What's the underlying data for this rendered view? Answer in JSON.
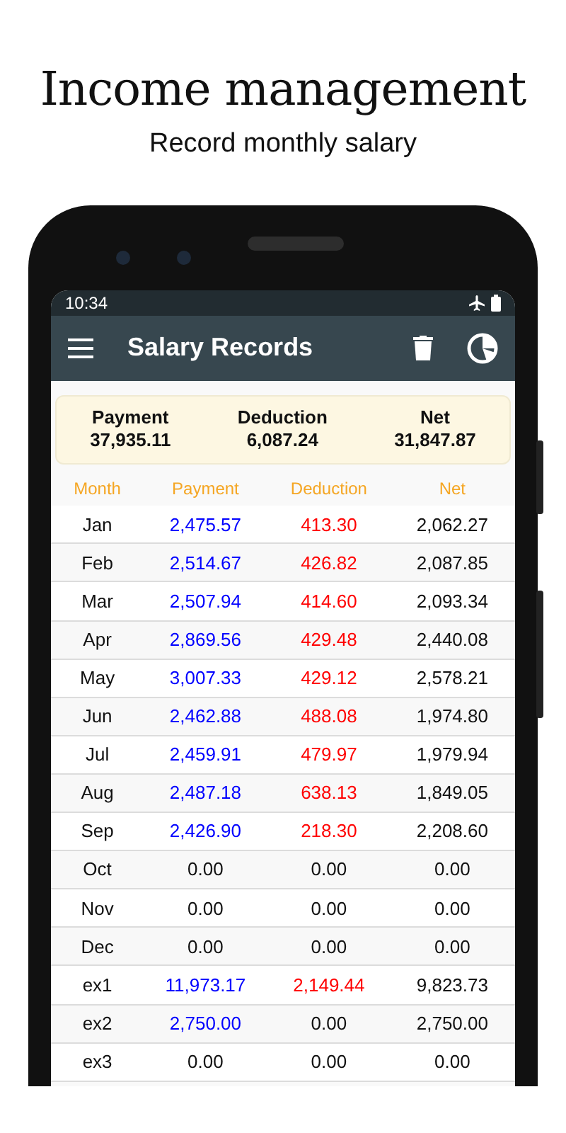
{
  "headline": "Income management",
  "subheadline": "Record monthly salary",
  "status_bar": {
    "time": "10:34"
  },
  "toolbar": {
    "title": "Salary Records"
  },
  "summary": [
    {
      "label": "Payment",
      "value": "37,935.11"
    },
    {
      "label": "Deduction",
      "value": "6,087.24"
    },
    {
      "label": "Net",
      "value": "31,847.87"
    }
  ],
  "table": {
    "columns": [
      "Month",
      "Payment",
      "Deduction",
      "Net"
    ],
    "rows": [
      {
        "month": "Jan",
        "payment": {
          "text": "2,475.57",
          "color": "#0000ff"
        },
        "deduction": {
          "text": "413.30",
          "color": "#ff0000"
        },
        "net": "2,062.27"
      },
      {
        "month": "Feb",
        "payment": {
          "text": "2,514.67",
          "color": "#0000ff"
        },
        "deduction": {
          "text": "426.82",
          "color": "#ff0000"
        },
        "net": "2,087.85"
      },
      {
        "month": "Mar",
        "payment": {
          "text": "2,507.94",
          "color": "#0000ff"
        },
        "deduction": {
          "text": "414.60",
          "color": "#ff0000"
        },
        "net": "2,093.34"
      },
      {
        "month": "Apr",
        "payment": {
          "text": "2,869.56",
          "color": "#0000ff"
        },
        "deduction": {
          "text": "429.48",
          "color": "#ff0000"
        },
        "net": "2,440.08"
      },
      {
        "month": "May",
        "payment": {
          "text": "3,007.33",
          "color": "#0000ff"
        },
        "deduction": {
          "text": "429.12",
          "color": "#ff0000"
        },
        "net": "2,578.21"
      },
      {
        "month": "Jun",
        "payment": {
          "text": "2,462.88",
          "color": "#0000ff"
        },
        "deduction": {
          "text": "488.08",
          "color": "#ff0000"
        },
        "net": "1,974.80"
      },
      {
        "month": "Jul",
        "payment": {
          "text": "2,459.91",
          "color": "#0000ff"
        },
        "deduction": {
          "text": "479.97",
          "color": "#ff0000"
        },
        "net": "1,979.94"
      },
      {
        "month": "Aug",
        "payment": {
          "text": "2,487.18",
          "color": "#0000ff"
        },
        "deduction": {
          "text": "638.13",
          "color": "#ff0000"
        },
        "net": "1,849.05"
      },
      {
        "month": "Sep",
        "payment": {
          "text": "2,426.90",
          "color": "#0000ff"
        },
        "deduction": {
          "text": "218.30",
          "color": "#ff0000"
        },
        "net": "2,208.60"
      },
      {
        "month": "Oct",
        "payment": {
          "text": "0.00",
          "color": "#111111"
        },
        "deduction": {
          "text": "0.00",
          "color": "#111111"
        },
        "net": "0.00"
      },
      {
        "month": "Nov",
        "payment": {
          "text": "0.00",
          "color": "#111111"
        },
        "deduction": {
          "text": "0.00",
          "color": "#111111"
        },
        "net": "0.00"
      },
      {
        "month": "Dec",
        "payment": {
          "text": "0.00",
          "color": "#111111"
        },
        "deduction": {
          "text": "0.00",
          "color": "#111111"
        },
        "net": "0.00"
      },
      {
        "month": "ex1",
        "payment": {
          "text": "11,973.17",
          "color": "#0000ff"
        },
        "deduction": {
          "text": "2,149.44",
          "color": "#ff0000"
        },
        "net": "9,823.73"
      },
      {
        "month": "ex2",
        "payment": {
          "text": "2,750.00",
          "color": "#0000ff"
        },
        "deduction": {
          "text": "0.00",
          "color": "#111111"
        },
        "net": "2,750.00"
      },
      {
        "month": "ex3",
        "payment": {
          "text": "0.00",
          "color": "#111111"
        },
        "deduction": {
          "text": "0.00",
          "color": "#111111"
        },
        "net": "0.00"
      }
    ]
  }
}
